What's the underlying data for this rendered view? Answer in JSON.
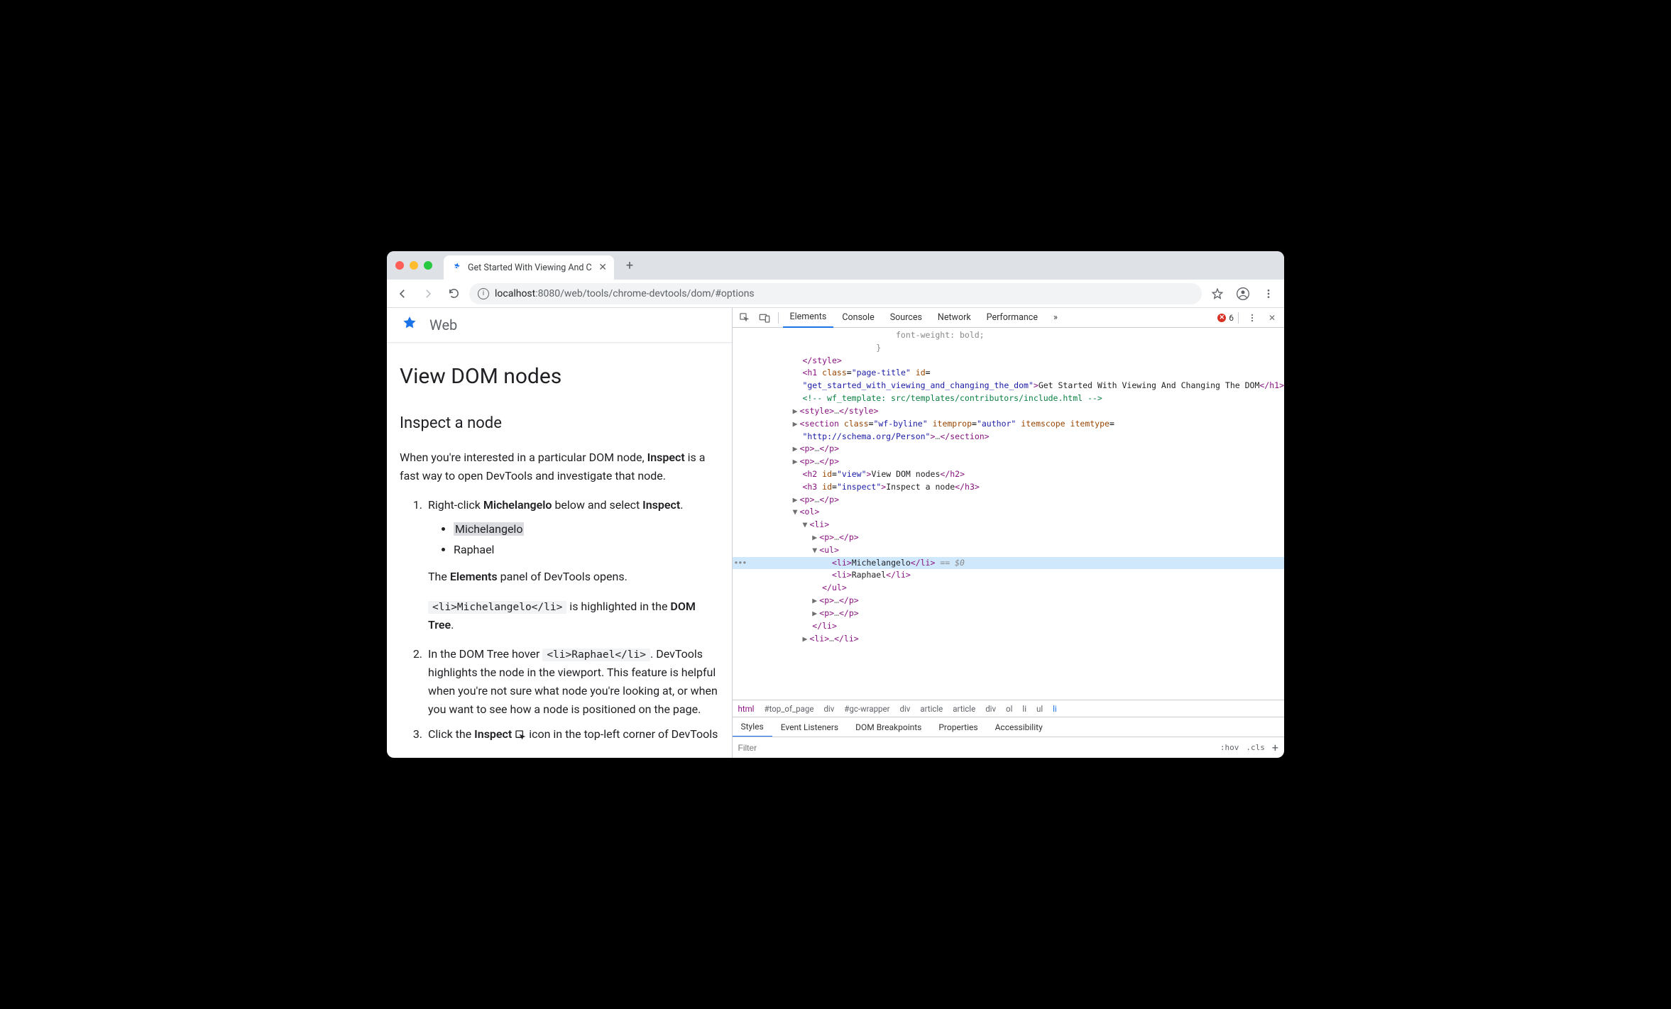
{
  "browser": {
    "tab_title": "Get Started With Viewing And C",
    "new_tab": "+",
    "url": {
      "host": "localhost",
      "port": ":8080",
      "path": "/web/tools/chrome-devtools/dom/#options"
    }
  },
  "page": {
    "site_name": "Web",
    "h1": "View DOM nodes",
    "h2": "Inspect a node",
    "intro_pre": "When you're interested in a particular DOM node, ",
    "intro_bold": "Inspect",
    "intro_post": " is a fast way to open DevTools and investigate that node.",
    "step1_pre": "Right-click ",
    "step1_bold": "Michelangelo",
    "step1_mid": " below and select ",
    "step1_bold2": "Inspect",
    "step1_post": ".",
    "bullets": [
      "Michelangelo",
      "Raphael"
    ],
    "elements_pre": "The ",
    "elements_bold": "Elements",
    "elements_post": " panel of DevTools opens.",
    "code1": "<li>Michelangelo</li>",
    "code1_mid": " is highlighted in the ",
    "code1_bold": "DOM Tree",
    "code1_post": ".",
    "step2_pre": "In the DOM Tree hover ",
    "step2_code": "<li>Raphael</li>",
    "step2_post": ". DevTools highlights the node in the viewport. This feature is helpful when you're not sure what node you're looking at, or when you want to see how a node is positioned on the page.",
    "step3_pre": "Click the ",
    "step3_bold": "Inspect",
    "step3_post": " icon in the top-left corner of DevTools"
  },
  "devtools": {
    "tabs": [
      "Elements",
      "Console",
      "Sources",
      "Network",
      "Performance"
    ],
    "overflow": "»",
    "error_count": "6",
    "elements": {
      "l0": "               font-weight: bold;",
      "l1": "             }",
      "h1_text": "Get Started With Viewing And Changing The DOM",
      "h1_class": "page-title",
      "h1_id": "get_started_with_viewing_and_changing_the_dom",
      "comment": "<!-- wf_template: src/templates/contributors/include.html -->",
      "section_class": "wf-byline",
      "section_itemprop": "author",
      "section_itemtype": "http://schema.org/Person",
      "h2_id": "view",
      "h2_text": "View DOM nodes",
      "h3_id": "inspect",
      "h3_text": "Inspect a node",
      "li1": "Michelangelo",
      "li2": "Raphael",
      "eq": " == ",
      "var": "$0"
    },
    "breadcrumb": [
      "html",
      "#top_of_page",
      "div",
      "#gc-wrapper",
      "div",
      "article",
      "article",
      "div",
      "ol",
      "li",
      "ul",
      "li"
    ],
    "styles_tabs": [
      "Styles",
      "Event Listeners",
      "DOM Breakpoints",
      "Properties",
      "Accessibility"
    ],
    "filter_placeholder": "Filter",
    "hov": ":hov",
    "cls": ".cls"
  }
}
